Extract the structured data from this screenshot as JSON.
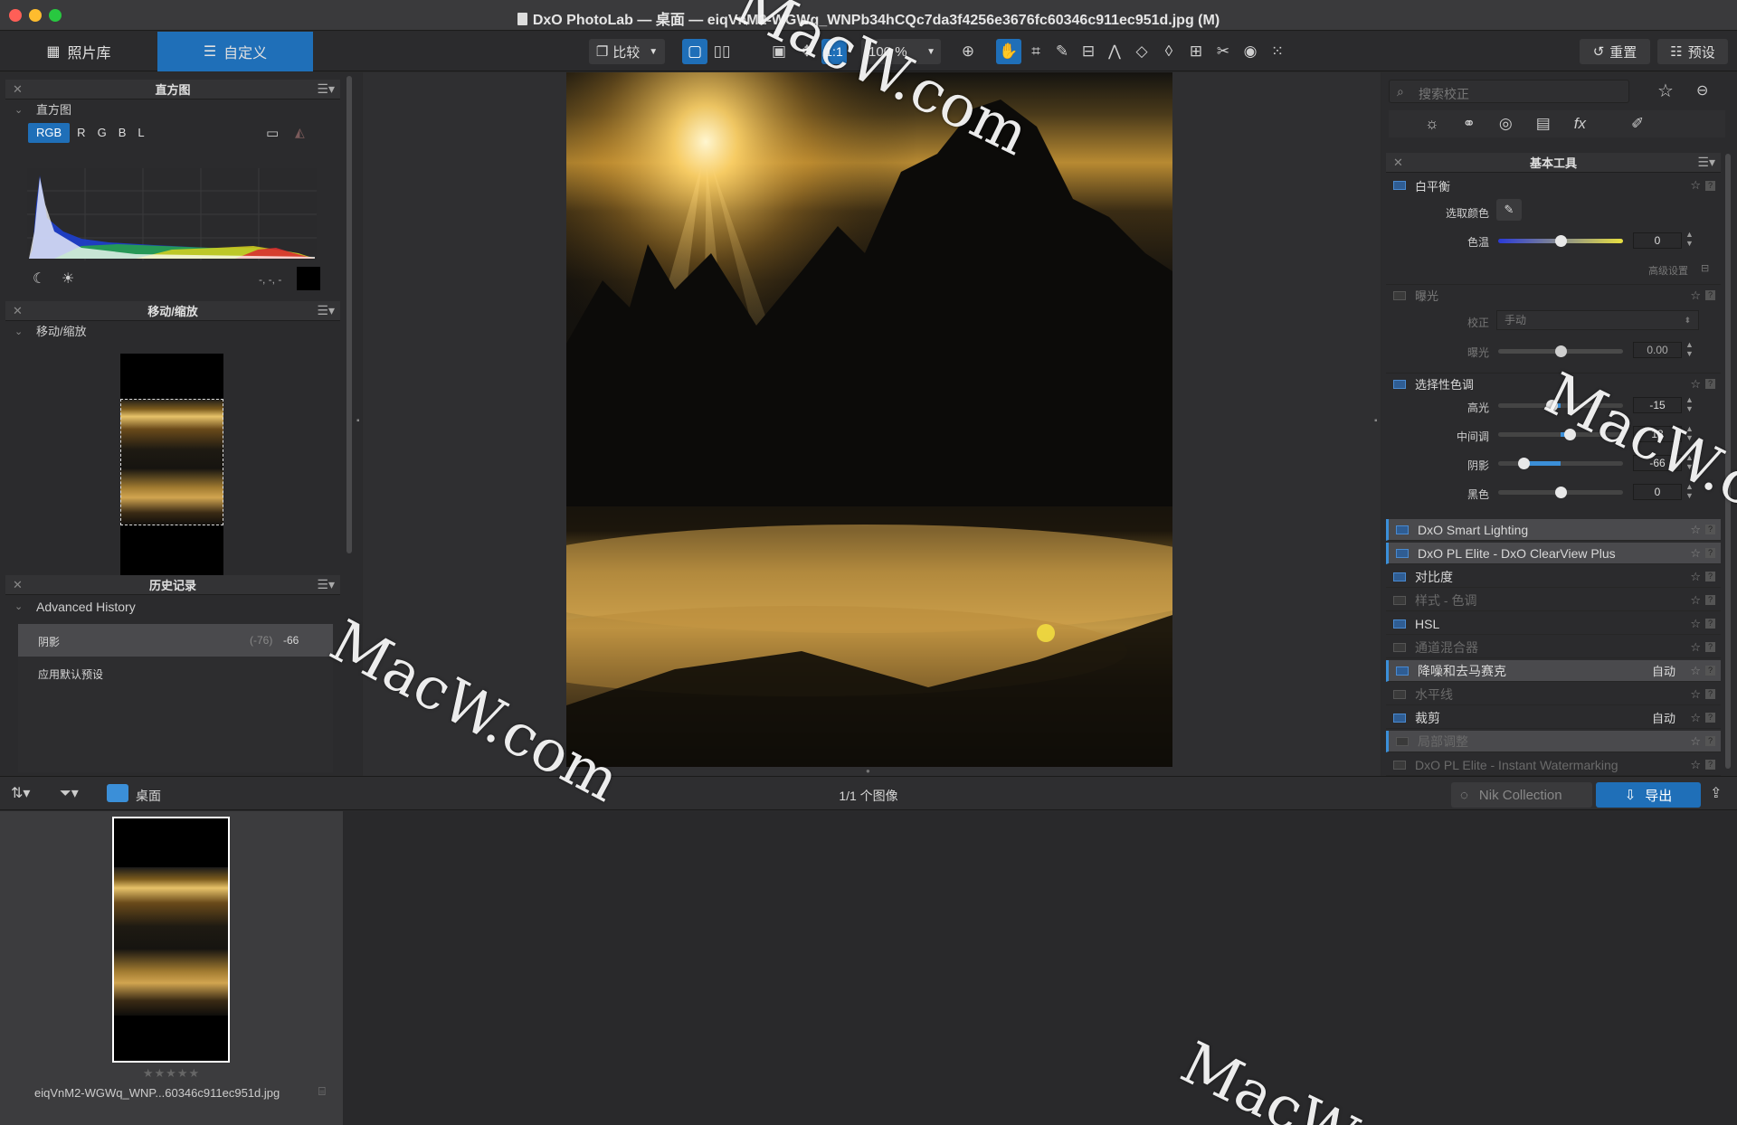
{
  "window": {
    "title": "DxO PhotoLab — 桌面 — eiqVnM2-WGWq_WNPb34hCQc7da3f4256e3676fc60346c911ec951d.jpg (M)"
  },
  "toolbar": {
    "tab_library": "照片库",
    "tab_customize": "自定义",
    "compare": "比较",
    "one_to_one": "1:1",
    "zoom": "100 %",
    "reset": "重置",
    "presets": "预设"
  },
  "histogram_panel": {
    "title": "直方图",
    "section": "直方图",
    "channels": [
      "RGB",
      "R",
      "G",
      "B",
      "L"
    ],
    "readout": "-, -, -"
  },
  "navigator_panel": {
    "title": "移动/缩放",
    "section": "移动/缩放"
  },
  "history_panel": {
    "title": "历史记录",
    "section": "Advanced History",
    "items": [
      {
        "label": "阴影",
        "prev": "(-76)",
        "value": "-66"
      },
      {
        "label": "应用默认预设",
        "prev": "",
        "value": ""
      }
    ]
  },
  "right_panel": {
    "search_placeholder": "搜索校正",
    "tools_title": "基本工具",
    "white_balance": {
      "label": "白平衡",
      "pick_color": "选取颜色",
      "temp_label": "色温",
      "temp_value": "0",
      "temp_pos": 0.5,
      "advanced": "高级设置"
    },
    "exposure": {
      "label": "曝光",
      "correction_label": "校正",
      "correction_value": "手动",
      "exposure_label": "曝光",
      "exposure_value": "0.00",
      "exposure_pos": 0.5
    },
    "selective_tone": {
      "label": "选择性色调",
      "rows": [
        {
          "label": "高光",
          "value": "-15",
          "pos": 0.43
        },
        {
          "label": "中间调",
          "value": "13",
          "pos": 0.57
        },
        {
          "label": "阴影",
          "value": "-66",
          "pos": 0.2
        },
        {
          "label": "黑色",
          "value": "0",
          "pos": 0.5
        }
      ]
    },
    "modules": [
      {
        "label": "DxO Smart Lighting",
        "auto": "",
        "state": "hl"
      },
      {
        "label": "DxO PL Elite - DxO ClearView Plus",
        "auto": "",
        "state": "hl"
      },
      {
        "label": "对比度",
        "auto": "",
        "state": "on"
      },
      {
        "label": "样式 - 色调",
        "auto": "",
        "state": "dim"
      },
      {
        "label": "HSL",
        "auto": "",
        "state": "on"
      },
      {
        "label": "通道混合器",
        "auto": "",
        "state": "dim"
      },
      {
        "label": "降噪和去马赛克",
        "auto": "自动",
        "state": "hl"
      },
      {
        "label": "水平线",
        "auto": "",
        "state": "dim"
      },
      {
        "label": "裁剪",
        "auto": "自动",
        "state": "on"
      },
      {
        "label": "局部调整",
        "auto": "",
        "state": "hldim"
      },
      {
        "label": "DxO PL Elite - Instant Watermarking",
        "auto": "",
        "state": "dim"
      }
    ]
  },
  "filmbar": {
    "folder": "桌面",
    "count": "1/1 个图像",
    "nik": "Nik Collection",
    "export": "导出"
  },
  "filmstrip": {
    "filename": "eiqVnM2-WGWq_WNP...60346c911ec951d.jpg",
    "rating": 0
  },
  "watermarks": [
    "MacW.com",
    "MacW.com",
    "MacW.c",
    "MacW"
  ],
  "colors": {
    "accent": "#1f6fb8",
    "panel": "#2b2b2d"
  }
}
